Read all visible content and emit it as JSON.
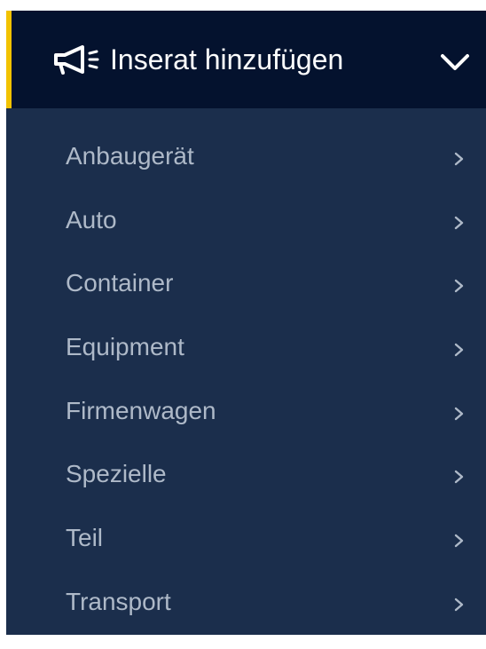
{
  "menu": {
    "header": {
      "icon": "megaphone-icon",
      "title": "Inserat hinzufügen",
      "toggle_icon": "chevron-down-icon",
      "expanded": true
    },
    "items": [
      {
        "label": "Anbaugerät",
        "icon": "chevron-right-icon"
      },
      {
        "label": "Auto",
        "icon": "chevron-right-icon"
      },
      {
        "label": "Container",
        "icon": "chevron-right-icon"
      },
      {
        "label": "Equipment",
        "icon": "chevron-right-icon"
      },
      {
        "label": "Firmenwagen",
        "icon": "chevron-right-icon"
      },
      {
        "label": "Spezielle",
        "icon": "chevron-right-icon"
      },
      {
        "label": "Teil",
        "icon": "chevron-right-icon"
      },
      {
        "label": "Transport",
        "icon": "chevron-right-icon"
      }
    ]
  },
  "colors": {
    "header_bg": "#04122e",
    "menu_bg": "#1b2e4c",
    "accent": "#f2c200",
    "header_text": "#ffffff",
    "item_text": "#aeb9c8"
  }
}
